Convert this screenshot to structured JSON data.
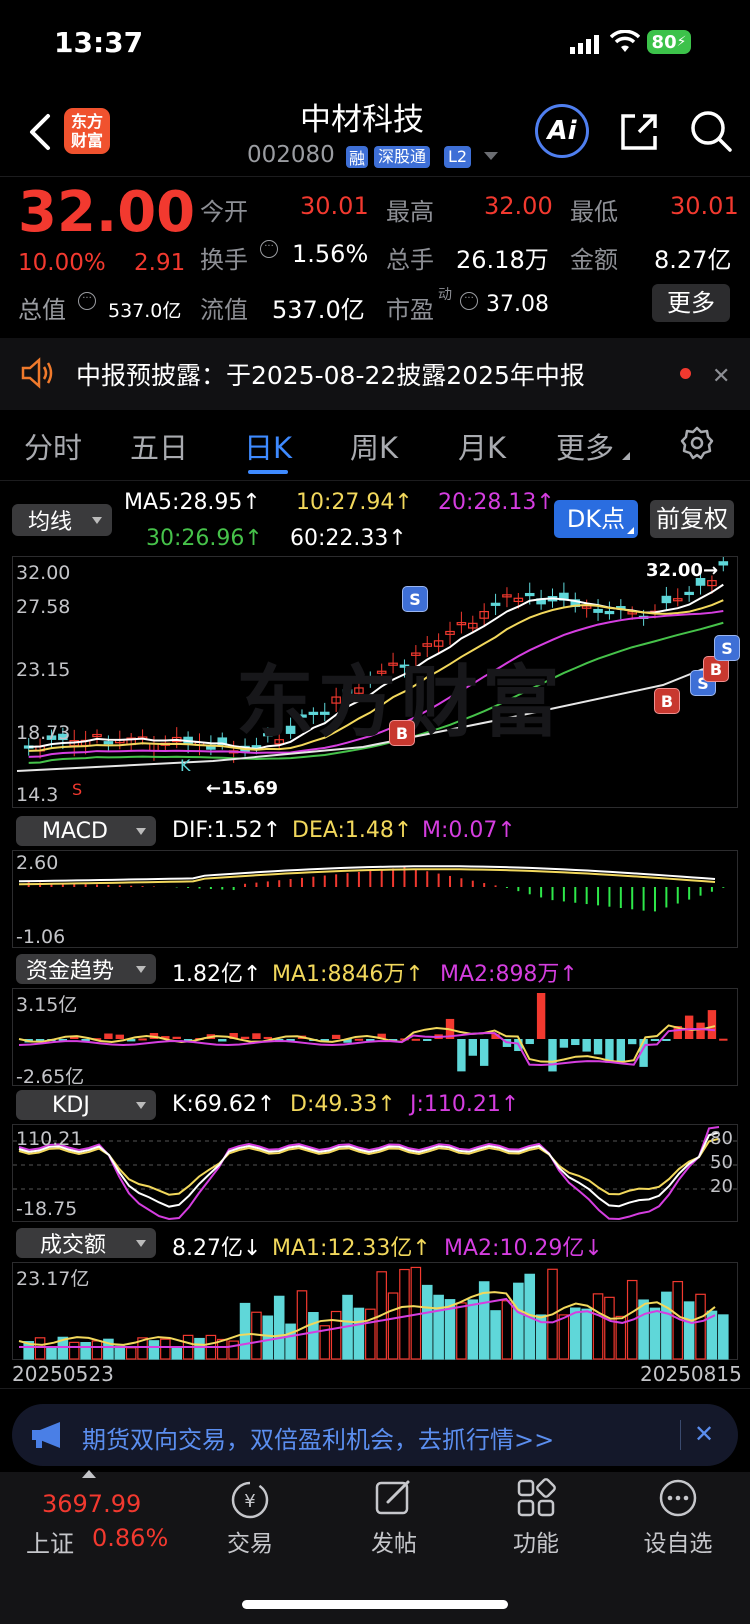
{
  "status": {
    "time": "13:37",
    "battery": "80"
  },
  "header": {
    "title": "中材科技",
    "code": "002080",
    "tag_rong": "融",
    "tag_sgt": "深股通",
    "tag_l2": "L2",
    "logo_line1": "东方",
    "logo_line2": "财富",
    "ai": "Ai"
  },
  "quote": {
    "price": "32.00",
    "pct": "10.00%",
    "chg": "2.91",
    "open_label": "今开",
    "open": "30.01",
    "high_label": "最高",
    "high": "32.00",
    "low_label": "最低",
    "low": "30.01",
    "turnover_label": "换手",
    "turnover": "1.56%",
    "vol_label": "总手",
    "vol": "26.18万",
    "amount_label": "金额",
    "amount": "8.27亿",
    "mktcap_label": "总值",
    "mktcap": "537.0亿",
    "float_label": "流值",
    "float": "537.0亿",
    "pe_label": "市盈",
    "pe_sup": "动",
    "pe": "37.08",
    "more": "更多"
  },
  "notice": {
    "text": "中报预披露：于2025-08-22披露2025年中报"
  },
  "tabs": [
    "分时",
    "五日",
    "日K",
    "周K",
    "月K",
    "更多"
  ],
  "ma_bar": {
    "selector": "均线",
    "ma5": "MA5:28.95↑",
    "ma10": "10:27.94↑",
    "ma20": "20:28.13↑",
    "ma30": "30:26.96↑",
    "ma60": "60:22.33↑",
    "dk": "DK点",
    "fq": "前复权"
  },
  "kline_axis": {
    "y1": "32.00",
    "y2": "27.58",
    "y3": "23.15",
    "y4": "18.73",
    "y5": "14.3",
    "high_mark": "32.00",
    "low_mark": "15.69",
    "k_mark": "K",
    "s_mark": "S"
  },
  "macd": {
    "selector": "MACD",
    "dif": "DIF:1.52↑",
    "dea": "DEA:1.48↑",
    "m": "M:0.07↑",
    "ymax": "2.60",
    "ymin": "-1.06"
  },
  "fund": {
    "selector": "资金趋势",
    "val": "1.82亿↑",
    "ma1": "MA1:8846万↑",
    "ma2": "MA2:898万↑",
    "ymax": "3.15亿",
    "ymin": "-2.65亿"
  },
  "kdj": {
    "selector": "KDJ",
    "k": "K:69.62↑",
    "d": "D:49.33↑",
    "j": "J:110.21↑",
    "ymax": "110.21",
    "ymin": "-18.75",
    "l80": "80",
    "l50": "50",
    "l20": "20"
  },
  "amount_ind": {
    "selector": "成交额",
    "val": "8.27亿↓",
    "ma1": "MA1:12.33亿↑",
    "ma2": "MA2:10.29亿↓",
    "ymax": "23.17亿",
    "date_start": "20250523",
    "date_end": "20250815"
  },
  "ad": {
    "text": "期货双向交易，双倍盈利机会，去抓行情>>"
  },
  "bottom": {
    "index_value": "3697.99",
    "index_name": "上证",
    "index_pct": "0.86%",
    "trade": "交易",
    "post": "发帖",
    "func": "功能",
    "watch": "设自选"
  }
}
